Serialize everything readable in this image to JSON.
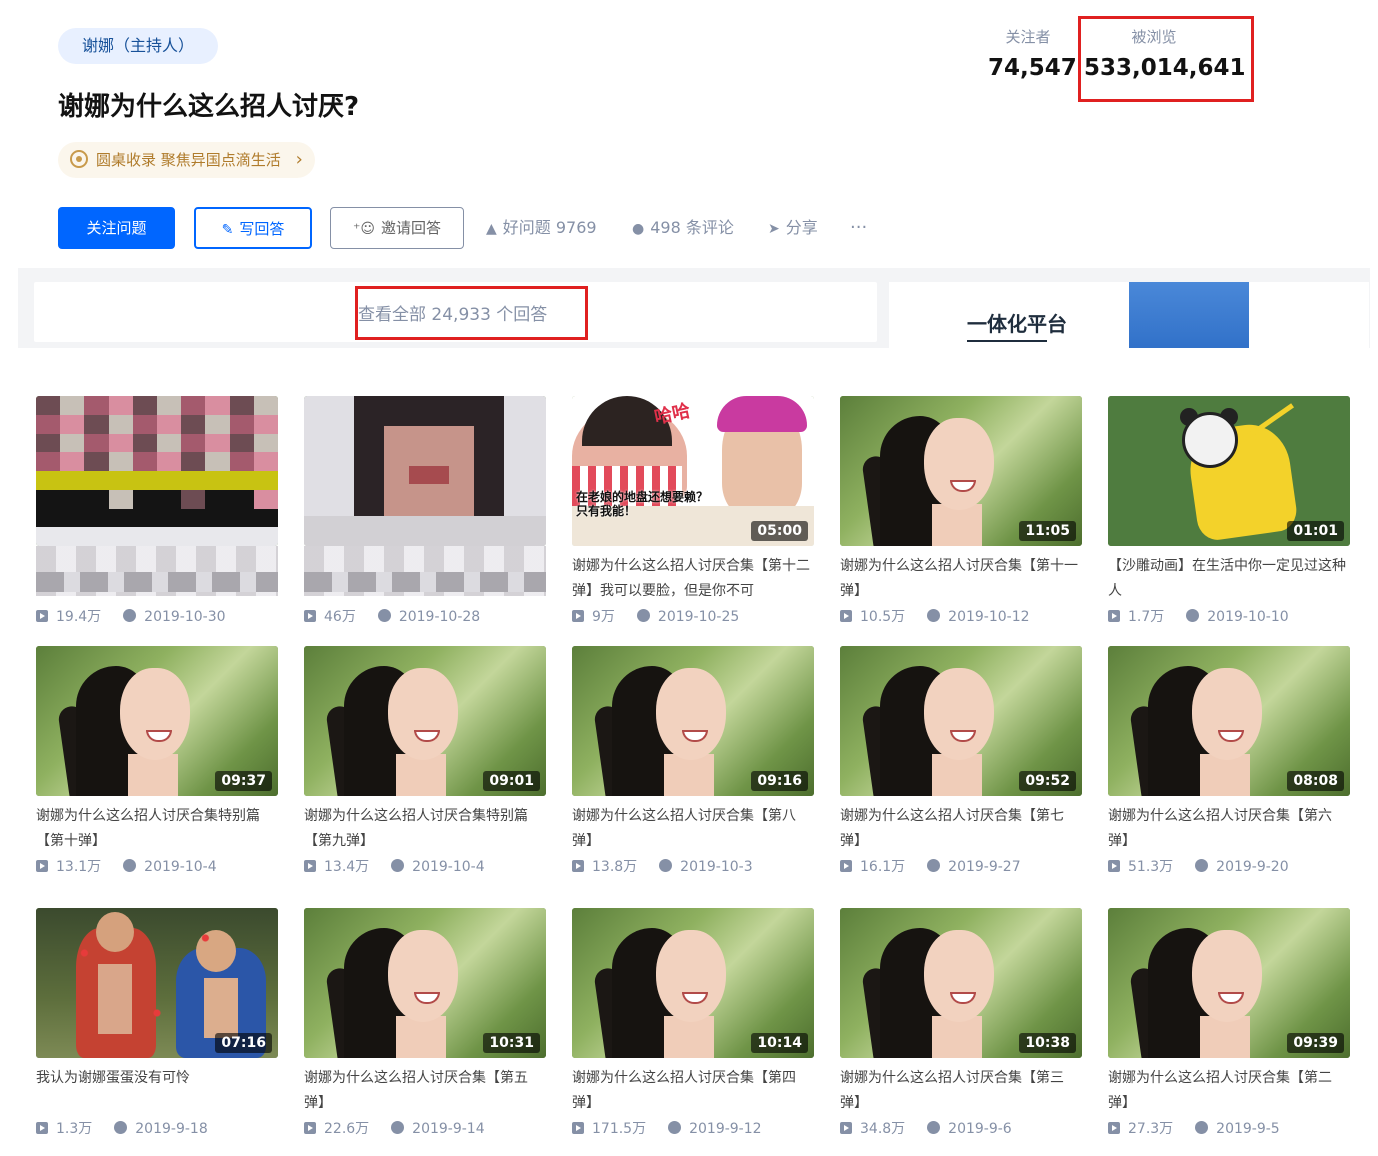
{
  "header": {
    "topic_tag": "谢娜（主持人）",
    "question_title": "谢娜为什么这么招人讨厌?",
    "roundtable_text": "圆桌收录 聚焦异国点滴生活",
    "roundtable_chevron": "›"
  },
  "stats": {
    "followers_label": "关注者",
    "followers_value": "74,547",
    "views_label": "被浏览",
    "views_value": "533,014,641"
  },
  "actions": {
    "follow_label": "关注问题",
    "write_label": "写回答",
    "invite_label": "邀请回答",
    "good_question": "好问题 9769",
    "comments": "498 条评论",
    "share": "分享",
    "more": "···",
    "icons": {
      "write": "pencil-icon",
      "invite": "add-user-icon",
      "good": "thumbs-up-icon",
      "comments": "comment-bubble-icon",
      "share": "paper-plane-icon"
    }
  },
  "answers": {
    "view_all": "查看全部 24,933 个回答"
  },
  "ad": {
    "headline": "一体化平台"
  },
  "videos": [
    {
      "duration": "",
      "title": "",
      "plays": "19.4万",
      "date": "2019-10-30"
    },
    {
      "duration": "",
      "title": "",
      "plays": "46万",
      "date": "2019-10-28"
    },
    {
      "duration": "05:00",
      "title": "谢娜为什么这么招人讨厌合集【第十二弹】我可以要脸，但是你不可",
      "plays": "9万",
      "date": "2019-10-25"
    },
    {
      "duration": "11:05",
      "title": "谢娜为什么这么招人讨厌合集【第十一弹】",
      "plays": "10.5万",
      "date": "2019-10-12"
    },
    {
      "duration": "01:01",
      "title": "【沙雕动画】在生活中你一定见过这种人",
      "plays": "1.7万",
      "date": "2019-10-10"
    },
    {
      "duration": "09:37",
      "title": "谢娜为什么这么招人讨厌合集特别篇【第十弹】",
      "plays": "13.1万",
      "date": "2019-10-4"
    },
    {
      "duration": "09:01",
      "title": "谢娜为什么这么招人讨厌合集特别篇【第九弹】",
      "plays": "13.4万",
      "date": "2019-10-4"
    },
    {
      "duration": "09:16",
      "title": "谢娜为什么这么招人讨厌合集【第八弹】",
      "plays": "13.8万",
      "date": "2019-10-3"
    },
    {
      "duration": "09:52",
      "title": "谢娜为什么这么招人讨厌合集【第七弹】",
      "plays": "16.1万",
      "date": "2019-9-27"
    },
    {
      "duration": "08:08",
      "title": "谢娜为什么这么招人讨厌合集【第六弹】",
      "plays": "51.3万",
      "date": "2019-9-20"
    },
    {
      "duration": "07:16",
      "title": "我认为谢娜蛋蛋没有可怜",
      "plays": "1.3万",
      "date": "2019-9-18"
    },
    {
      "duration": "10:31",
      "title": "谢娜为什么这么招人讨厌合集【第五弹】",
      "plays": "22.6万",
      "date": "2019-9-14"
    },
    {
      "duration": "10:14",
      "title": "谢娜为什么这么招人讨厌合集【第四弹】",
      "plays": "171.5万",
      "date": "2019-9-12"
    },
    {
      "duration": "10:38",
      "title": "谢娜为什么这么招人讨厌合集【第三弹】",
      "plays": "34.8万",
      "date": "2019-9-6"
    },
    {
      "duration": "09:39",
      "title": "谢娜为什么这么招人讨厌合集【第二弹】",
      "plays": "27.3万",
      "date": "2019-9-5"
    }
  ],
  "colors": {
    "primary_blue": "#0066ff",
    "highlight_red": "#e02020",
    "muted_text": "#8590a6"
  }
}
